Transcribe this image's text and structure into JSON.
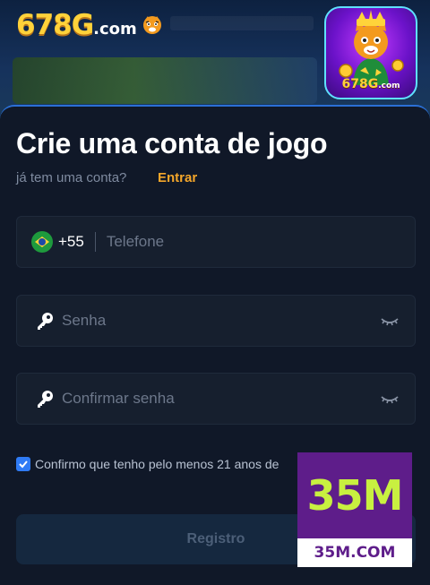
{
  "header": {
    "logo_text": "678G",
    "logo_suffix": ".com",
    "app_icon_label": "678G",
    "app_icon_suffix": ".com"
  },
  "form": {
    "title": "Crie uma conta de jogo",
    "subtitle": "já tem uma conta?",
    "login_link": "Entrar",
    "phone": {
      "country_flag": "brazil-flag-icon",
      "dial_code": "+55",
      "placeholder": "Telefone"
    },
    "password": {
      "placeholder": "Senha"
    },
    "confirm_password": {
      "placeholder": "Confirmar senha"
    },
    "terms_text": "Confirmo que tenho pelo menos 21 anos de",
    "terms_checked": true,
    "register_label": "Registro"
  },
  "overlay_badge": {
    "big_text": "35M",
    "small_text": "35M.COM"
  },
  "colors": {
    "accent": "#f4a62a",
    "checkbox": "#2f7bf5",
    "panel_border": "#2b6fd6",
    "badge_purple": "#5e1d8a",
    "badge_green": "#c8f040"
  }
}
